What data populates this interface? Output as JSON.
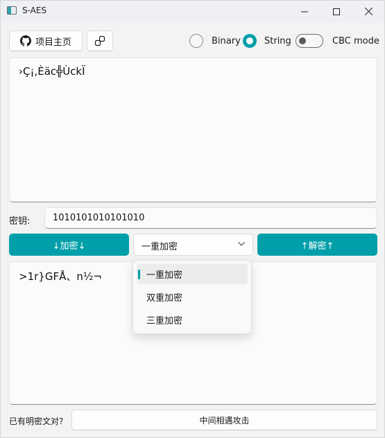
{
  "window": {
    "title": "S-AES"
  },
  "toolbar": {
    "home_label": "项目主页",
    "mode_binary_label": "Binary",
    "mode_string_label": "String",
    "mode_selected": "String",
    "cbc_label": "CBC mode",
    "cbc_enabled": false
  },
  "input_text": "›Ç¡,Èäc╬ÙckÏ",
  "key": {
    "label": "密钥:",
    "value": "1010101010101010"
  },
  "actions": {
    "encrypt_label": "↓加密↓",
    "decrypt_label": "↑解密↑",
    "round_selected": "一重加密",
    "round_options": [
      "一重加密",
      "双重加密",
      "三重加密"
    ]
  },
  "output_text": ">1r}GFÅ、n½¬",
  "bottom": {
    "question_label": "已有明密文对?",
    "attack_label": "中间相遇攻击"
  },
  "colors": {
    "accent": "#009faa"
  }
}
